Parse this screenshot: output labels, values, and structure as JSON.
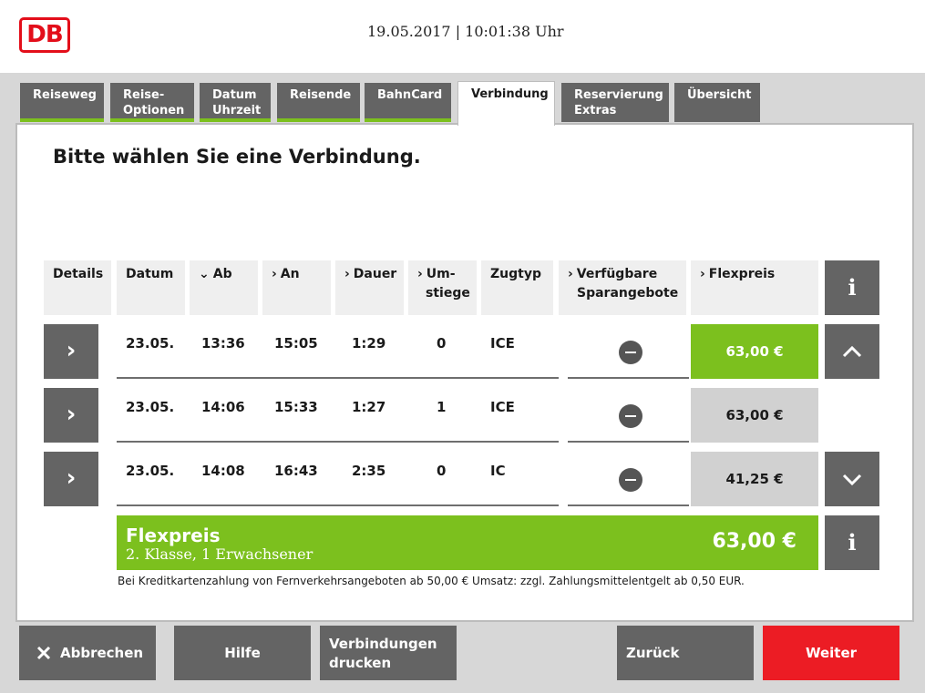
{
  "header": {
    "logo_text": "DB",
    "datetime": "19.05.2017 | 10:01:38 Uhr"
  },
  "tabs": [
    {
      "line1": "Reiseweg",
      "line2": "",
      "state": "done"
    },
    {
      "line1": "Reise-",
      "line2": "Optionen",
      "state": "done"
    },
    {
      "line1": "Datum",
      "line2": "Uhrzeit",
      "state": "done"
    },
    {
      "line1": "Reisende",
      "line2": "",
      "state": "done"
    },
    {
      "line1": "BahnCard",
      "line2": "",
      "state": "done"
    },
    {
      "line1": "Verbindung",
      "line2": "",
      "state": "active"
    },
    {
      "line1": "Reservierung",
      "line2": "Extras",
      "state": "todo"
    },
    {
      "line1": "Übersicht",
      "line2": "",
      "state": "todo"
    }
  ],
  "page": {
    "title": "Bitte wählen Sie eine Verbindung."
  },
  "table": {
    "headers": {
      "details": "Details",
      "datum": "Datum",
      "ab": "Ab",
      "an": "An",
      "dauer": "Dauer",
      "umstiege_1": "Um-",
      "umstiege_2": "stiege",
      "zugtyp": "Zugtyp",
      "spar_1": "Verfügbare",
      "spar_2": "Sparangebote",
      "flexpreis": "Flexpreis"
    },
    "sort_icons": {
      "sorted": "chevron-down",
      "sortable": "chevron-right"
    },
    "rows": [
      {
        "datum": "23.05.",
        "ab": "13:36",
        "an": "15:05",
        "dauer": "1:29",
        "umstiege": "0",
        "zugtyp": "ICE",
        "sparangebote": "minus-icon",
        "flexpreis": "63,00 €",
        "selected": true
      },
      {
        "datum": "23.05.",
        "ab": "14:06",
        "an": "15:33",
        "dauer": "1:27",
        "umstiege": "1",
        "zugtyp": "ICE",
        "sparangebote": "minus-icon",
        "flexpreis": "63,00 €",
        "selected": false
      },
      {
        "datum": "23.05.",
        "ab": "14:08",
        "an": "16:43",
        "dauer": "2:35",
        "umstiege": "0",
        "zugtyp": "IC",
        "sparangebote": "minus-icon",
        "flexpreis": "41,25 €",
        "selected": false
      }
    ]
  },
  "summary": {
    "title": "Flexpreis",
    "subtitle": "2. Klasse, 1 Erwachsener",
    "price": "63,00 €"
  },
  "note": "Bei Kreditkartenzahlung von Fernverkehrsangeboten ab 50,00 € Umsatz: zzgl. Zahlungsmittelentgelt ab 0,50 EUR.",
  "footer": {
    "cancel": "Abbrechen",
    "help": "Hilfe",
    "print_1": "Verbindungen",
    "print_2": "drucken",
    "back": "Zurück",
    "next": "Weiter"
  },
  "colors": {
    "brand_red": "#e30e1a",
    "accent_green": "#7cc01e",
    "button_gray": "#646464",
    "next_red": "#ec1c24"
  }
}
